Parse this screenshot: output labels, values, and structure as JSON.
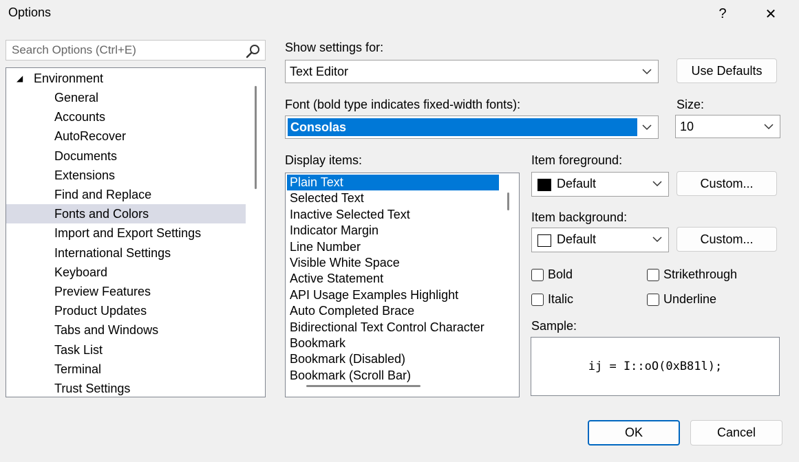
{
  "window": {
    "title": "Options",
    "help_label": "?",
    "close_label": "✕"
  },
  "search": {
    "placeholder": "Search Options (Ctrl+E)",
    "icon": "search-icon"
  },
  "tree": {
    "root": {
      "arrow": "◢",
      "label": "Environment",
      "expanded": true
    },
    "children": [
      {
        "label": "General"
      },
      {
        "label": "Accounts"
      },
      {
        "label": "AutoRecover"
      },
      {
        "label": "Documents"
      },
      {
        "label": "Extensions"
      },
      {
        "label": "Find and Replace"
      },
      {
        "label": "Fonts and Colors",
        "selected": true
      },
      {
        "label": "Import and Export Settings"
      },
      {
        "label": "International Settings"
      },
      {
        "label": "Keyboard"
      },
      {
        "label": "Preview Features"
      },
      {
        "label": "Product Updates"
      },
      {
        "label": "Tabs and Windows"
      },
      {
        "label": "Task List"
      },
      {
        "label": "Terminal"
      },
      {
        "label": "Trust Settings"
      }
    ]
  },
  "settings": {
    "show_for_label": "Show settings for:",
    "show_for_value": "Text Editor",
    "use_defaults": "Use Defaults",
    "font_label": "Font (bold type indicates fixed-width fonts):",
    "font_value": "Consolas",
    "size_label": "Size:",
    "size_value": "10",
    "display_items_label": "Display items:",
    "display_items": [
      {
        "label": "Plain Text",
        "selected": true
      },
      {
        "label": "Selected Text"
      },
      {
        "label": "Inactive Selected Text"
      },
      {
        "label": "Indicator Margin"
      },
      {
        "label": "Line Number"
      },
      {
        "label": "Visible White Space"
      },
      {
        "label": "Active Statement"
      },
      {
        "label": "API Usage Examples Highlight"
      },
      {
        "label": "Auto Completed Brace"
      },
      {
        "label": "Bidirectional Text Control Character"
      },
      {
        "label": "Bookmark"
      },
      {
        "label": "Bookmark (Disabled)"
      },
      {
        "label": "Bookmark (Scroll Bar)"
      }
    ],
    "fg_label": "Item foreground:",
    "fg_value": "Default",
    "fg_color": "#000000",
    "bg_label": "Item background:",
    "bg_value": "Default",
    "bg_color": "#ffffff",
    "custom_label": "Custom...",
    "bold": "Bold",
    "italic": "Italic",
    "strikethrough": "Strikethrough",
    "underline": "Underline",
    "sample_label": "Sample:",
    "sample_text": "ij = I::oO(0xB81l);"
  },
  "footer": {
    "ok": "OK",
    "cancel": "Cancel",
    "accent": "#0067c0"
  },
  "colors": {
    "selection": "#0078d7",
    "tree_selection": "#d9dbe6"
  }
}
